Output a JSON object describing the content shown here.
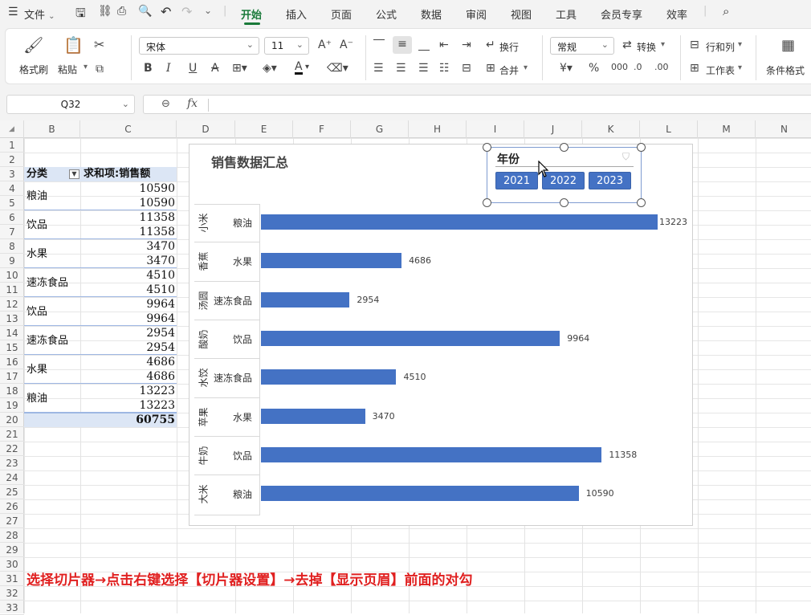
{
  "menu": {
    "file_label": "文件",
    "tabs": [
      "开始",
      "插入",
      "页面",
      "公式",
      "数据",
      "审阅",
      "视图",
      "工具",
      "会员专享",
      "效率"
    ]
  },
  "ribbon": {
    "format_painter": "格式刷",
    "paste": "粘贴",
    "font_name": "宋体",
    "font_size": "11",
    "wrap": "换行",
    "merge": "合并",
    "number_format": "常规",
    "convert": "转换",
    "row_col": "行和列",
    "worksheet": "工作表",
    "cond_format": "条件格式"
  },
  "formula_bar": {
    "name_box": "Q32",
    "fx": "fx",
    "content": ""
  },
  "columns": [
    "B",
    "C",
    "D",
    "E",
    "F",
    "G",
    "H",
    "I",
    "J",
    "K",
    "L",
    "M",
    "N"
  ],
  "rows": [
    "1",
    "2",
    "3",
    "4",
    "5",
    "6",
    "7",
    "8",
    "9",
    "10",
    "11",
    "12",
    "13",
    "14",
    "15",
    "16",
    "17",
    "18",
    "19",
    "20",
    "21",
    "22",
    "23",
    "24",
    "25",
    "26",
    "27",
    "28",
    "29",
    "30",
    "31",
    "32",
    "33"
  ],
  "pivot": {
    "header_category": "分类",
    "header_sum": "求和项:销售额",
    "rows": [
      {
        "label": "",
        "value": "10590"
      },
      {
        "label": "粮油",
        "value": "10590"
      },
      {
        "label": "",
        "value": "11358"
      },
      {
        "label": "饮品",
        "value": "11358"
      },
      {
        "label": "",
        "value": "3470"
      },
      {
        "label": "水果",
        "value": "3470"
      },
      {
        "label": "",
        "value": "4510"
      },
      {
        "label": "速冻食品",
        "value": "4510"
      },
      {
        "label": "",
        "value": "9964"
      },
      {
        "label": "饮品",
        "value": "9964"
      },
      {
        "label": "",
        "value": "2954"
      },
      {
        "label": "速冻食品",
        "value": "2954"
      },
      {
        "label": "",
        "value": "4686"
      },
      {
        "label": "水果",
        "value": "4686"
      },
      {
        "label": "",
        "value": "13223"
      },
      {
        "label": "粮油",
        "value": "13223"
      }
    ],
    "total": "60755"
  },
  "chart_data": {
    "type": "bar",
    "title": "销售数据汇总",
    "orientation": "horizontal",
    "categories_outer": [
      "小米",
      "香蕉",
      "汤圆",
      "酸奶",
      "水饺",
      "苹果",
      "牛奶",
      "大米"
    ],
    "categories_inner": [
      "粮油",
      "水果",
      "速冻食品",
      "饮品",
      "速冻食品",
      "水果",
      "饮品",
      "粮油"
    ],
    "values": [
      13223,
      4686,
      2954,
      9964,
      4510,
      3470,
      11358,
      10590
    ],
    "xlim": [
      0,
      13223
    ],
    "data_labels": true,
    "bar_color": "#4472c4"
  },
  "slicer": {
    "title": "年份",
    "items": [
      "2021",
      "2022",
      "2023"
    ]
  },
  "instruction": "选择切片器→点击右键选择【切片器设置】→去掉【显示页眉】前面的对勾"
}
